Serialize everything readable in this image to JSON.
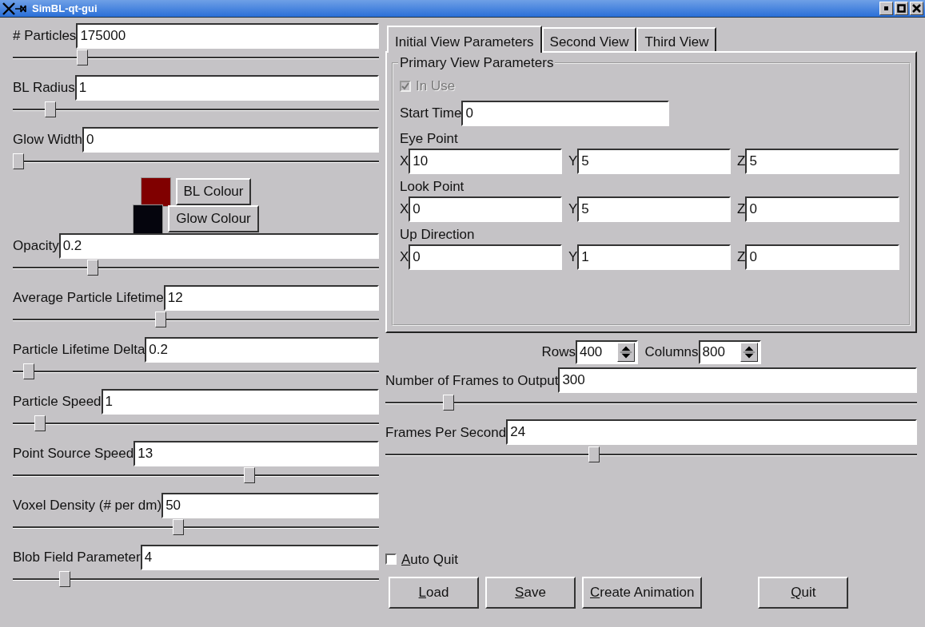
{
  "window": {
    "title": "SimBL-qt-gui"
  },
  "left_panel": [
    {
      "kind": "field",
      "label": "# Particles",
      "value": "175000",
      "level": 0.18
    },
    {
      "kind": "field",
      "label": "BL Radius",
      "value": "1",
      "level": 0.09
    },
    {
      "kind": "field",
      "label": "Glow Width",
      "value": "0",
      "level": 0.0
    },
    {
      "kind": "colour",
      "label": "BL Colour",
      "color": "#800000"
    },
    {
      "kind": "colour",
      "label": "Glow Colour",
      "color": "#05050d"
    },
    {
      "kind": "field",
      "label": "Opacity",
      "value": "0.2",
      "level": 0.21
    },
    {
      "kind": "field",
      "label": "Average Particle Lifetime",
      "value": "12",
      "level": 0.4
    },
    {
      "kind": "field",
      "label": "Particle Lifetime Delta",
      "value": "0.2",
      "level": 0.03
    },
    {
      "kind": "field",
      "label": "Particle Speed",
      "value": "1",
      "level": 0.06
    },
    {
      "kind": "field",
      "label": "Point Source Speed",
      "value": "13",
      "level": 0.65
    },
    {
      "kind": "field",
      "label": "Voxel Density (# per dm)",
      "value": "50",
      "level": 0.45
    },
    {
      "kind": "field",
      "label": "Blob Field Parameter",
      "value": "4",
      "level": 0.13
    }
  ],
  "tabs": [
    {
      "label": "Initial View Parameters",
      "selected": true
    },
    {
      "label": "Second View",
      "selected": false
    },
    {
      "label": "Third View",
      "selected": false
    }
  ],
  "group": {
    "title": "Primary View Parameters",
    "in_use": {
      "label": "In Use",
      "checked": true,
      "disabled": true
    },
    "start_time": {
      "label": "Start Time",
      "value": "0"
    },
    "points": [
      {
        "label": "Eye Point",
        "coords": [
          {
            "axis": "X",
            "value": "10"
          },
          {
            "axis": "Y",
            "value": "5"
          },
          {
            "axis": "Z",
            "value": "5"
          }
        ]
      },
      {
        "label": "Look Point",
        "coords": [
          {
            "axis": "X",
            "value": "0"
          },
          {
            "axis": "Y",
            "value": "5"
          },
          {
            "axis": "Z",
            "value": "0"
          }
        ]
      },
      {
        "label": "Up Direction",
        "coords": [
          {
            "axis": "X",
            "value": "0"
          },
          {
            "axis": "Y",
            "value": "1"
          },
          {
            "axis": "Z",
            "value": "0"
          }
        ]
      }
    ]
  },
  "spinners": [
    {
      "label": "Rows",
      "value": "400"
    },
    {
      "label": "Columns",
      "value": "800"
    }
  ],
  "output_fields": [
    {
      "label": "Number of Frames to Output",
      "value": "300",
      "level": 0.11
    },
    {
      "label": "Frames Per Second",
      "value": "24",
      "level": 0.39
    }
  ],
  "auto_quit": {
    "label": "Auto Quit",
    "checked": false,
    "mnemonic_first": true
  },
  "buttons": [
    {
      "label": "Load",
      "mnemonic_first": true,
      "spaced": false
    },
    {
      "label": "Save",
      "mnemonic_first": true,
      "spaced": false
    },
    {
      "label": "Create Animation",
      "mnemonic_first": true,
      "spaced": false
    },
    {
      "label": "Quit",
      "mnemonic_first": true,
      "spaced": true
    }
  ]
}
